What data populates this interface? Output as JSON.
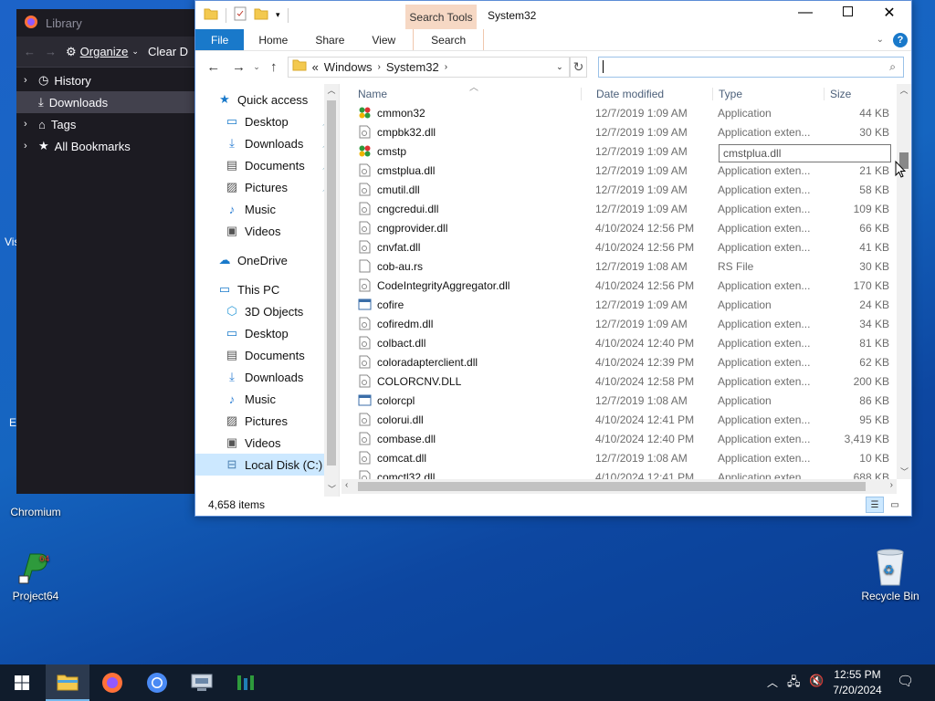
{
  "desktop": {
    "icons": [
      {
        "label": "Chromium"
      },
      {
        "label": "Project64"
      },
      {
        "label": "Recycle Bin"
      }
    ],
    "edge_fragments": [
      "Vis",
      "E"
    ]
  },
  "library": {
    "title": "Library",
    "toolbar": {
      "organize": "Organize",
      "clear": "Clear D"
    },
    "items": [
      {
        "label": "History",
        "selected": false
      },
      {
        "label": "Downloads",
        "selected": true
      },
      {
        "label": "Tags",
        "selected": false
      },
      {
        "label": "All Bookmarks",
        "selected": false
      }
    ]
  },
  "explorer": {
    "title": "System32",
    "contextual_tab_group": "Search Tools",
    "tabs": [
      "File",
      "Home",
      "Share",
      "View",
      "Search"
    ],
    "breadcrumb": {
      "overflow": "«",
      "parts": [
        "Windows",
        "System32"
      ]
    },
    "search_placeholder": "",
    "nav": [
      {
        "label": "Quick access",
        "level": 0,
        "icon": "star-icon",
        "pinned": false
      },
      {
        "label": "Desktop",
        "level": 1,
        "icon": "desktop-icon",
        "pinned": true
      },
      {
        "label": "Downloads",
        "level": 1,
        "icon": "download-icon",
        "pinned": true
      },
      {
        "label": "Documents",
        "level": 1,
        "icon": "document-icon",
        "pinned": true
      },
      {
        "label": "Pictures",
        "level": 1,
        "icon": "picture-icon",
        "pinned": true
      },
      {
        "label": "Music",
        "level": 1,
        "icon": "music-icon",
        "pinned": false
      },
      {
        "label": "Videos",
        "level": 1,
        "icon": "video-icon",
        "pinned": false
      },
      {
        "label": "OneDrive",
        "level": 0,
        "icon": "cloud-icon",
        "pinned": false
      },
      {
        "label": "This PC",
        "level": 0,
        "icon": "pc-icon",
        "pinned": false
      },
      {
        "label": "3D Objects",
        "level": 1,
        "icon": "cube-icon",
        "pinned": false
      },
      {
        "label": "Desktop",
        "level": 1,
        "icon": "desktop-icon",
        "pinned": false
      },
      {
        "label": "Documents",
        "level": 1,
        "icon": "document-icon",
        "pinned": false
      },
      {
        "label": "Downloads",
        "level": 1,
        "icon": "download-icon",
        "pinned": false
      },
      {
        "label": "Music",
        "level": 1,
        "icon": "music-icon",
        "pinned": false
      },
      {
        "label": "Pictures",
        "level": 1,
        "icon": "picture-icon",
        "pinned": false
      },
      {
        "label": "Videos",
        "level": 1,
        "icon": "video-icon",
        "pinned": false
      },
      {
        "label": "Local Disk (C:)",
        "level": 1,
        "icon": "drive-icon",
        "pinned": false,
        "selected": true
      }
    ],
    "columns": {
      "name": "Name",
      "date": "Date modified",
      "type": "Type",
      "size": "Size"
    },
    "files": [
      {
        "name": "cmmon32",
        "date": "12/7/2019 1:09 AM",
        "type": "Application",
        "size": "44 KB",
        "icon": "app-icon"
      },
      {
        "name": "cmpbk32.dll",
        "date": "12/7/2019 1:09 AM",
        "type": "Application exten...",
        "size": "30 KB",
        "icon": "dll-icon"
      },
      {
        "name": "cmstp",
        "date": "12/7/2019 1:09 AM",
        "type": "",
        "size": "8",
        "icon": "app-icon"
      },
      {
        "name": "cmstplua.dll",
        "date": "12/7/2019 1:09 AM",
        "type": "Application exten...",
        "size": "21 KB",
        "icon": "dll-icon"
      },
      {
        "name": "cmutil.dll",
        "date": "12/7/2019 1:09 AM",
        "type": "Application exten...",
        "size": "58 KB",
        "icon": "dll-icon"
      },
      {
        "name": "cngcredui.dll",
        "date": "12/7/2019 1:09 AM",
        "type": "Application exten...",
        "size": "109 KB",
        "icon": "dll-icon"
      },
      {
        "name": "cngprovider.dll",
        "date": "4/10/2024 12:56 PM",
        "type": "Application exten...",
        "size": "66 KB",
        "icon": "dll-icon"
      },
      {
        "name": "cnvfat.dll",
        "date": "4/10/2024 12:56 PM",
        "type": "Application exten...",
        "size": "41 KB",
        "icon": "dll-icon"
      },
      {
        "name": "cob-au.rs",
        "date": "12/7/2019 1:08 AM",
        "type": "RS File",
        "size": "30 KB",
        "icon": "file-icon"
      },
      {
        "name": "CodeIntegrityAggregator.dll",
        "date": "4/10/2024 12:56 PM",
        "type": "Application exten...",
        "size": "170 KB",
        "icon": "dll-icon"
      },
      {
        "name": "cofire",
        "date": "12/7/2019 1:09 AM",
        "type": "Application",
        "size": "24 KB",
        "icon": "exe-icon"
      },
      {
        "name": "cofiredm.dll",
        "date": "12/7/2019 1:09 AM",
        "type": "Application exten...",
        "size": "34 KB",
        "icon": "dll-icon"
      },
      {
        "name": "colbact.dll",
        "date": "4/10/2024 12:40 PM",
        "type": "Application exten...",
        "size": "81 KB",
        "icon": "dll-icon"
      },
      {
        "name": "coloradapterclient.dll",
        "date": "4/10/2024 12:39 PM",
        "type": "Application exten...",
        "size": "62 KB",
        "icon": "dll-icon"
      },
      {
        "name": "COLORCNV.DLL",
        "date": "4/10/2024 12:58 PM",
        "type": "Application exten...",
        "size": "200 KB",
        "icon": "dll-icon"
      },
      {
        "name": "colorcpl",
        "date": "12/7/2019 1:08 AM",
        "type": "Application",
        "size": "86 KB",
        "icon": "exe-icon"
      },
      {
        "name": "colorui.dll",
        "date": "4/10/2024 12:41 PM",
        "type": "Application exten...",
        "size": "95 KB",
        "icon": "dll-icon"
      },
      {
        "name": "combase.dll",
        "date": "4/10/2024 12:40 PM",
        "type": "Application exten...",
        "size": "3,419 KB",
        "icon": "dll-icon"
      },
      {
        "name": "comcat.dll",
        "date": "12/7/2019 1:08 AM",
        "type": "Application exten...",
        "size": "10 KB",
        "icon": "dll-icon"
      },
      {
        "name": "comctl32.dll",
        "date": "4/10/2024 12:41 PM",
        "type": "Application exten...",
        "size": "688 KB",
        "icon": "dll-icon"
      }
    ],
    "tooltip": "cmstplua.dll",
    "status": "4,658 items"
  },
  "taskbar": {
    "time": "12:55 PM",
    "date": "7/20/2024",
    "apps": [
      "file-explorer-icon",
      "firefox-icon",
      "chromium-icon",
      "remote-desktop-icon",
      "project64-icon"
    ]
  }
}
